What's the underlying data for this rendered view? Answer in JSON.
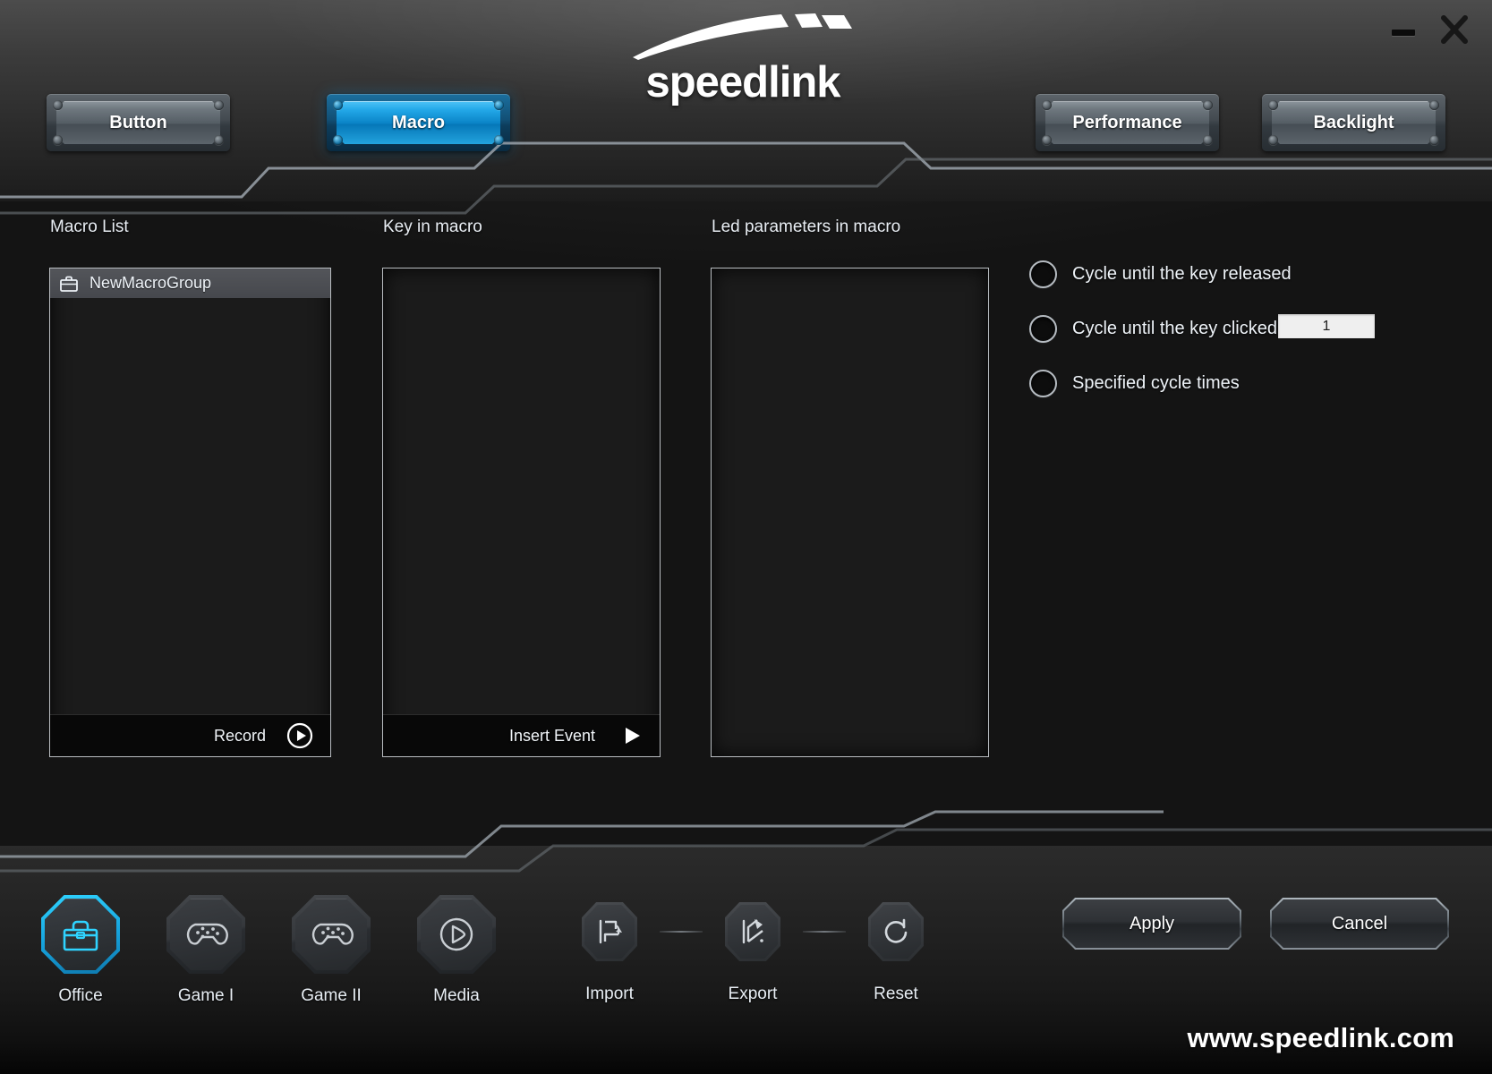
{
  "app": {
    "brand": "speedlink",
    "site_url": "www.speedlink.com"
  },
  "window_controls": {
    "minimize_icon": "minimize-icon",
    "close_icon": "close-icon"
  },
  "tabs": {
    "left": [
      {
        "id": "button",
        "label": "Button",
        "active": false
      },
      {
        "id": "macro",
        "label": "Macro",
        "active": true
      }
    ],
    "right": [
      {
        "id": "performance",
        "label": "Performance",
        "active": false
      },
      {
        "id": "backlight",
        "label": "Backlight",
        "active": false
      }
    ]
  },
  "panels": {
    "macro_list": {
      "title": "Macro List",
      "items": [
        {
          "label": "NewMacroGroup",
          "icon": "briefcase-icon",
          "selected": true
        }
      ],
      "footer": {
        "label": "Record",
        "icon": "record-play-circle-icon"
      }
    },
    "key_in_macro": {
      "title": "Key in macro",
      "items": [],
      "footer": {
        "label": "Insert Event",
        "icon": "play-triangle-icon"
      }
    },
    "led_parameters": {
      "title": "Led parameters in macro",
      "items": []
    }
  },
  "cycle_options": {
    "radios": [
      {
        "id": "until-released",
        "label": "Cycle until the key released",
        "selected": false
      },
      {
        "id": "until-clicked",
        "label": "Cycle until the key clicked again",
        "selected": false
      },
      {
        "id": "specified-times",
        "label": "Specified cycle times",
        "selected": false
      }
    ],
    "cycle_times_value": "1",
    "cycle_times_placeholder": "1"
  },
  "profiles": [
    {
      "id": "office",
      "label": "Office",
      "icon": "briefcase-icon",
      "active": true
    },
    {
      "id": "game1",
      "label": "Game I",
      "icon": "gamepad-icon",
      "active": false
    },
    {
      "id": "game2",
      "label": "Game II",
      "icon": "gamepad-icon",
      "active": false
    },
    {
      "id": "media",
      "label": "Media",
      "icon": "play-circle-icon",
      "active": false
    }
  ],
  "tools": [
    {
      "id": "import",
      "label": "Import",
      "icon": "import-icon"
    },
    {
      "id": "export",
      "label": "Export",
      "icon": "export-icon"
    },
    {
      "id": "reset",
      "label": "Reset",
      "icon": "reset-icon"
    }
  ],
  "actions": [
    {
      "id": "apply",
      "label": "Apply"
    },
    {
      "id": "cancel",
      "label": "Cancel"
    }
  ],
  "colors": {
    "accent_cyan": "#2fd3ff",
    "tab_active_blue": "#0a83c6",
    "panel_bg": "#1b1b1b",
    "panel_border": "#b9bdc1",
    "text": "#e8eef5"
  }
}
